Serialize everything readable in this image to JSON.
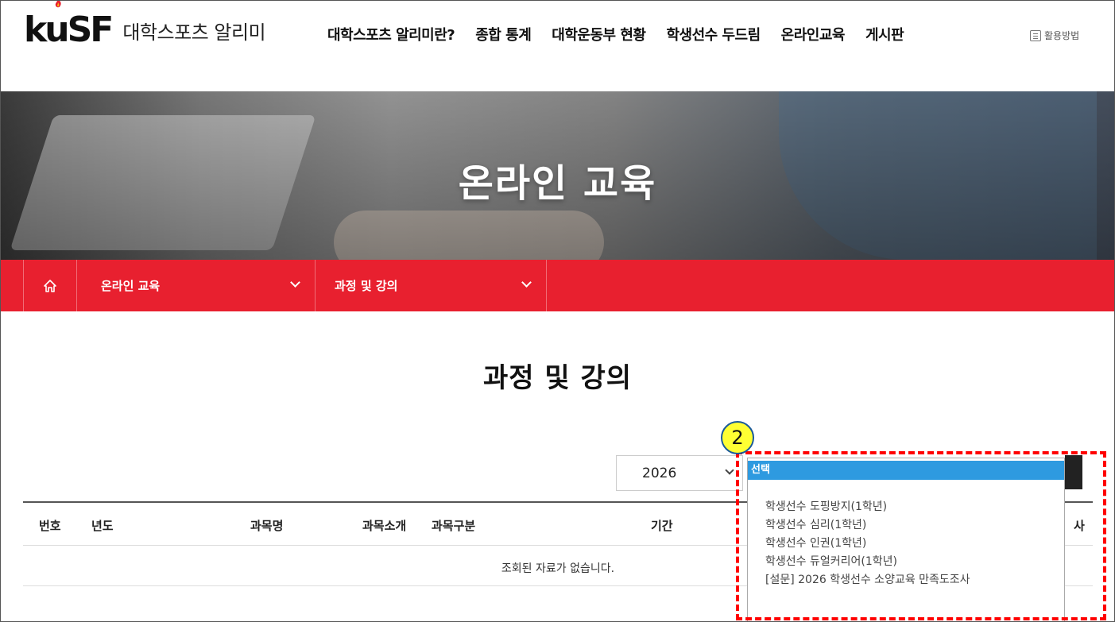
{
  "header": {
    "logo_mark": "kuSF",
    "site_name": "대학스포츠 알리미",
    "nav": [
      "대학스포츠 알리미란?",
      "종합 통계",
      "대학운동부 현황",
      "학생선수 두드림",
      "온라인교육",
      "게시판"
    ],
    "help_label": "활용방법"
  },
  "banner": {
    "title": "온라인 교육"
  },
  "subnav": {
    "home_icon": "home-icon",
    "level1": "온라인 교육",
    "level2": "과정 및 강의"
  },
  "main": {
    "title": "과정 및 강의",
    "year_select": {
      "value": "2026"
    },
    "table": {
      "headers": [
        "번호",
        "년도",
        "과목명",
        "과목소개",
        "과목구분",
        "기간"
      ],
      "last_header_fragment": "사",
      "empty_message": "조회된 자료가 없습니다."
    }
  },
  "dropdown": {
    "selected": "선택",
    "options": [
      "학생선수 도핑방지(1학년)",
      "학생선수 심리(1학년)",
      "학생선수 인권(1학년)",
      "학생선수 듀얼커리어(1학년)",
      "[설문] 2026 학생선수 소양교육 만족도조사"
    ]
  },
  "annotation": {
    "number": "2",
    "color": "#ff0000"
  },
  "colors": {
    "accent_red": "#e8202f",
    "selection_blue": "#2e9ae0"
  }
}
